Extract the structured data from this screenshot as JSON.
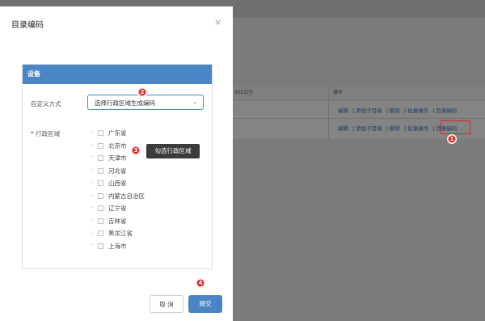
{
  "background": {
    "table": {
      "headers": [
        "2022년)",
        "操作"
      ],
      "rows": [
        {
          "ops": [
            "编辑",
            "添加子目录",
            "删除",
            "批量操作",
            "目录编码"
          ]
        },
        {
          "ops": [
            "编辑",
            "添加子目录",
            "删除",
            "批量操作",
            "目录编码"
          ]
        }
      ]
    }
  },
  "modal": {
    "title": "目录编码",
    "close_label": "×",
    "panel_title": "设备",
    "custom_mode_label": "自定义方式",
    "custom_mode_value": "选择行政区域生成编码",
    "region_label": "* 行政区域",
    "regions": [
      "广东省",
      "北京市",
      "天津市",
      "河北省",
      "山西省",
      "内蒙古自治区",
      "辽宁省",
      "吉林省",
      "黑龙江省",
      "上海市"
    ],
    "cancel_label": "取 消",
    "submit_label": "提交"
  },
  "tooltip": "勾选行政区域",
  "badges": [
    "1",
    "2",
    "3",
    "4"
  ],
  "colors": {
    "accent": "#4a86c5",
    "badge": "#e12b2b",
    "highlight": "#e02020"
  }
}
